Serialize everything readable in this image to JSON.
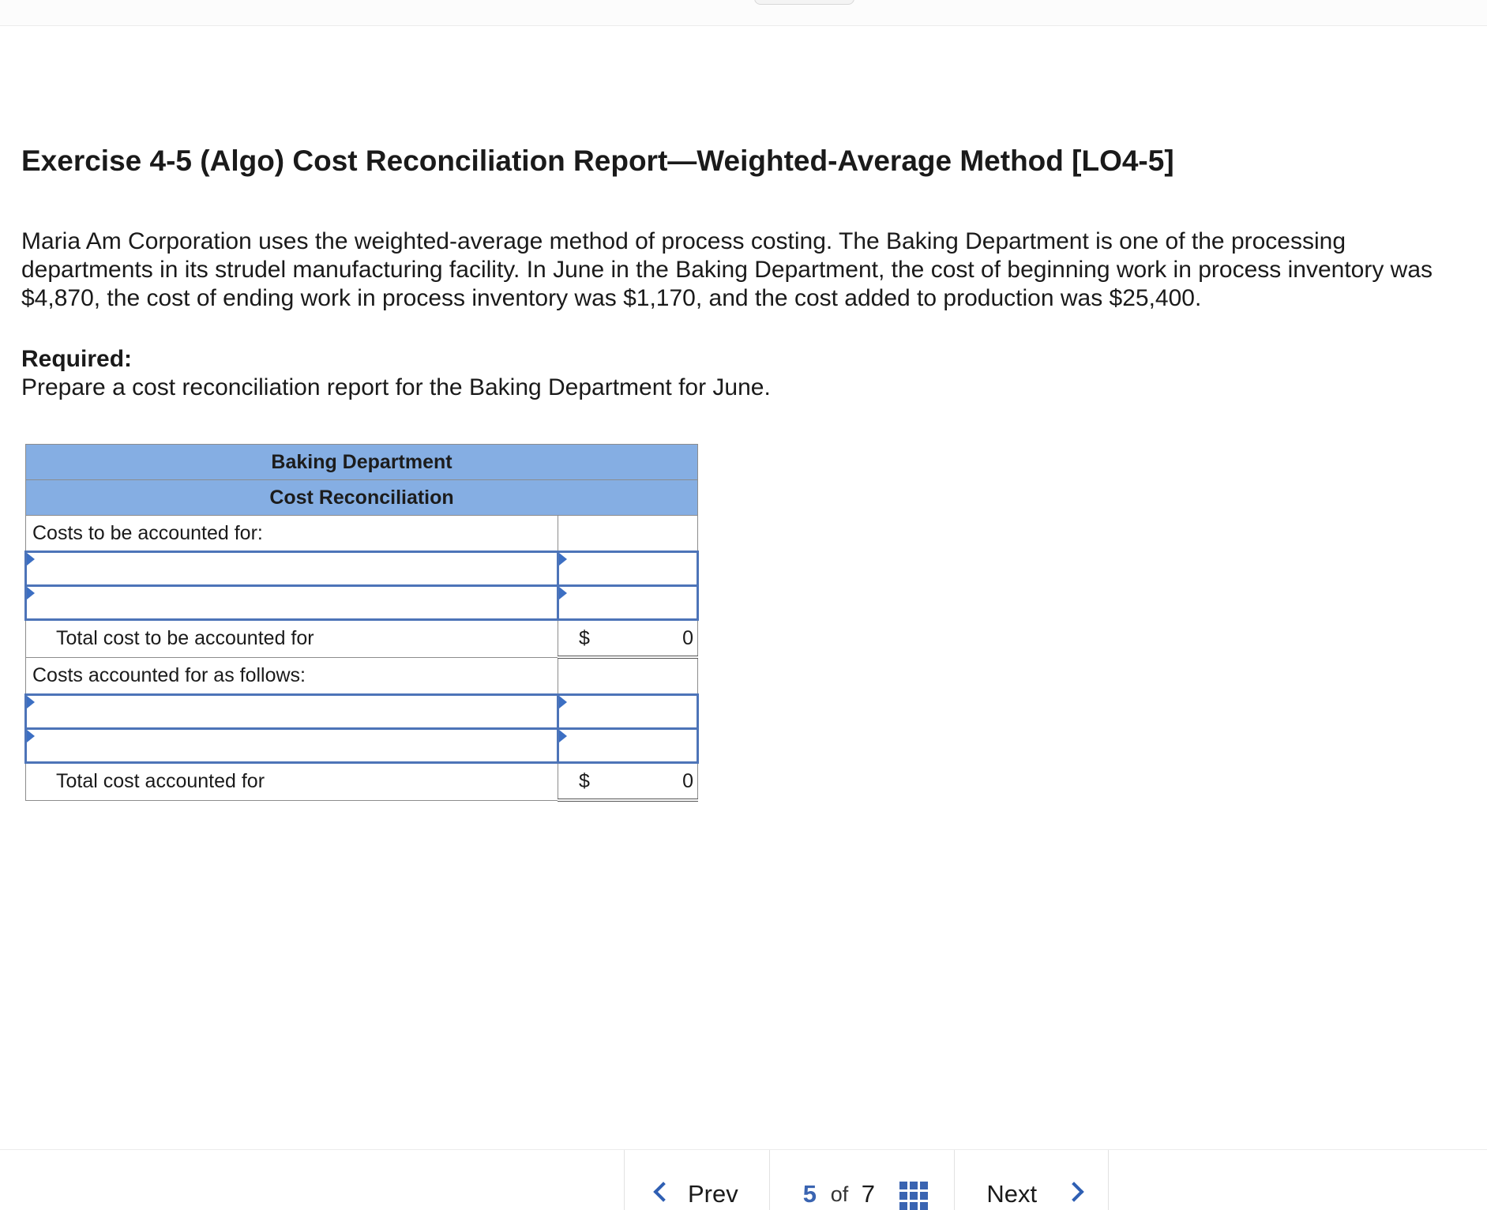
{
  "exercise": {
    "title": "Exercise 4-5 (Algo) Cost Reconciliation Report—Weighted-Average Method [LO4-5]",
    "problem": "Maria Am Corporation uses the weighted-average method of process costing. The Baking Department is one of the processing departments in its strudel manufacturing facility. In June in the Baking Department, the cost of beginning work in process inventory was $4,870, the cost of ending work in process inventory was $1,170, and the cost added to production was $25,400.",
    "required_label": "Required:",
    "required_text": "Prepare a cost reconciliation report for the Baking Department for June."
  },
  "table": {
    "header1": "Baking Department",
    "header2": "Cost Reconciliation",
    "section1_label": "Costs to be accounted for:",
    "total1_label": "Total cost to be accounted for",
    "total1_currency": "$",
    "total1_value": "0",
    "section2_label": "Costs accounted for as follows:",
    "total2_label": "Total cost accounted for",
    "total2_currency": "$",
    "total2_value": "0",
    "input_rows": [
      {
        "label": "",
        "amount": ""
      },
      {
        "label": "",
        "amount": ""
      },
      {
        "label": "",
        "amount": ""
      },
      {
        "label": "",
        "amount": ""
      }
    ]
  },
  "pager": {
    "prev_label": "Prev",
    "current": "5",
    "of_label": "of",
    "total": "7",
    "next_label": "Next"
  },
  "icons": [
    "chevron-left-icon",
    "grid-icon",
    "chevron-right-icon"
  ],
  "colors": {
    "header_bg": "#85aee3",
    "input_border": "#4d74b8",
    "accent": "#3a64b1"
  }
}
